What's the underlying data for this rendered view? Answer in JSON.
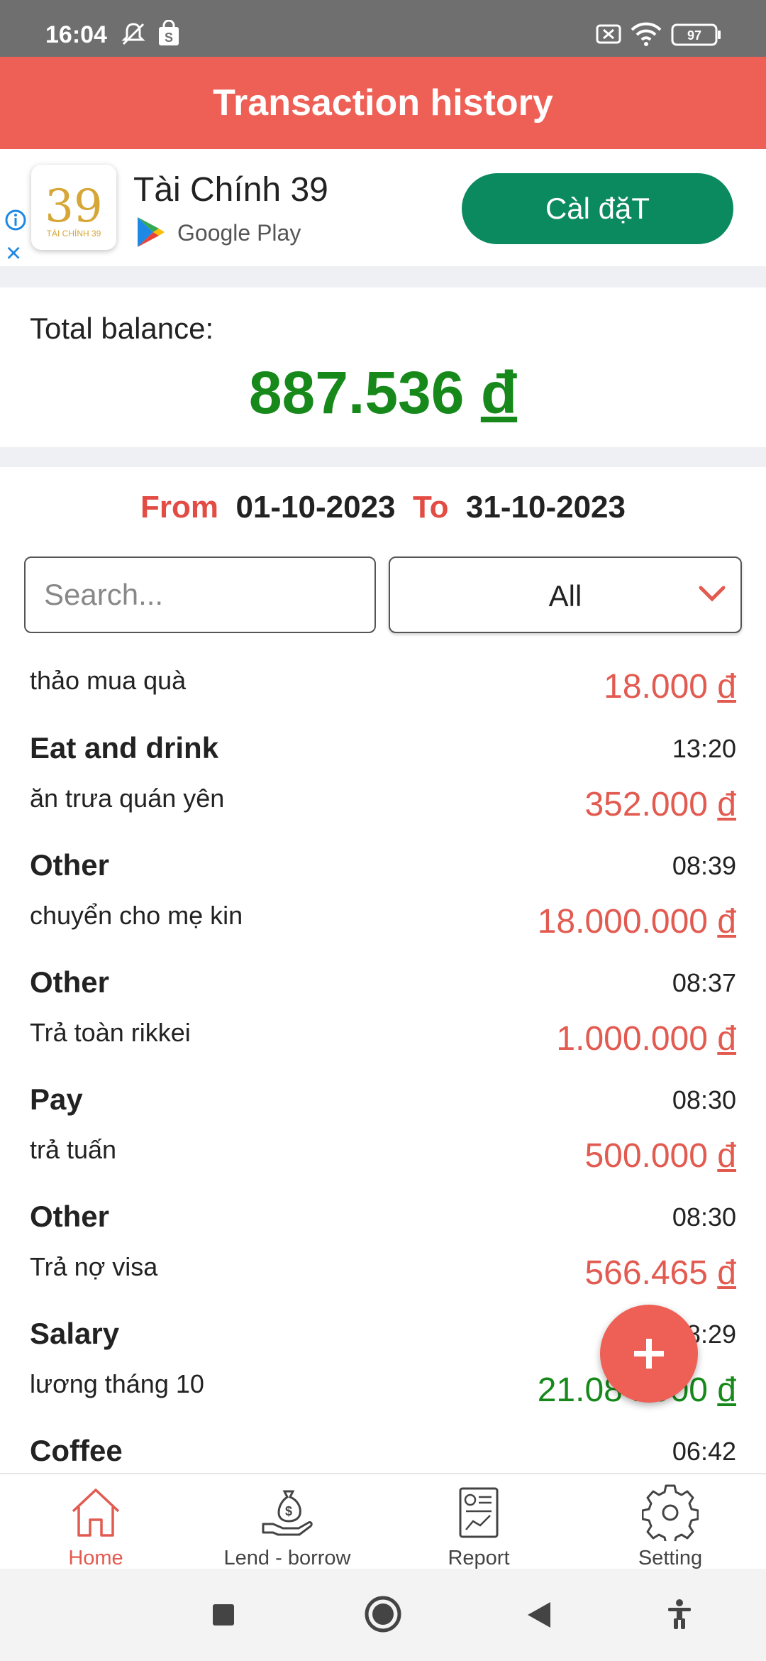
{
  "status_bar": {
    "time": "16:04",
    "battery": "97"
  },
  "header": {
    "title": "Transaction history"
  },
  "ad": {
    "logo_number": "39",
    "logo_caption": "TÀI CHÍNH 39",
    "app_name": "Tài Chính 39",
    "store_label": "Google Play",
    "install_label": "Càl đặT",
    "close_symbol": "×"
  },
  "balance": {
    "label": "Total balance:",
    "amount": "887.536",
    "currency": "đ"
  },
  "date_range": {
    "from_label": "From",
    "from_value": "01-10-2023",
    "to_label": "To",
    "to_value": "31-10-2023"
  },
  "search": {
    "placeholder": "Search..."
  },
  "filter": {
    "selected": "All"
  },
  "transactions": [
    {
      "category": "",
      "time": "",
      "note": "thảo mua quà",
      "amount": "18.000",
      "currency": "đ",
      "type": "expense"
    },
    {
      "category": "Eat and drink",
      "time": "13:20",
      "note": "ăn trưa quán yên",
      "amount": "352.000",
      "currency": "đ",
      "type": "expense"
    },
    {
      "category": "Other",
      "time": "08:39",
      "note": "chuyển cho mẹ kin",
      "amount": "18.000.000",
      "currency": "đ",
      "type": "expense"
    },
    {
      "category": "Other",
      "time": "08:37",
      "note": "Trả toàn rikkei",
      "amount": "1.000.000",
      "currency": "đ",
      "type": "expense"
    },
    {
      "category": "Pay",
      "time": "08:30",
      "note": "trả tuấn",
      "amount": "500.000",
      "currency": "đ",
      "type": "expense"
    },
    {
      "category": "Other",
      "time": "08:30",
      "note": "Trả nợ visa",
      "amount": "566.465",
      "currency": "đ",
      "type": "expense"
    },
    {
      "category": "Salary",
      "time": "08:29",
      "note": "lương tháng 10",
      "amount": "21.084.000",
      "currency": "đ",
      "type": "income"
    },
    {
      "category": "Coffee",
      "time": "06:42",
      "note": "",
      "amount": "",
      "currency": "",
      "type": "expense"
    }
  ],
  "fab": {
    "symbol": "+"
  },
  "bottom_nav": [
    {
      "label": "Home",
      "icon": "home-icon",
      "active": true
    },
    {
      "label": "Lend - borrow",
      "icon": "money-bag-hand-icon",
      "active": false
    },
    {
      "label": "Report",
      "icon": "report-icon",
      "active": false
    },
    {
      "label": "Setting",
      "icon": "gear-icon",
      "active": false
    }
  ],
  "colors": {
    "header": "#ee5f55",
    "income": "#17891b",
    "expense": "#e25a50",
    "install_button": "#0b8a5f"
  }
}
